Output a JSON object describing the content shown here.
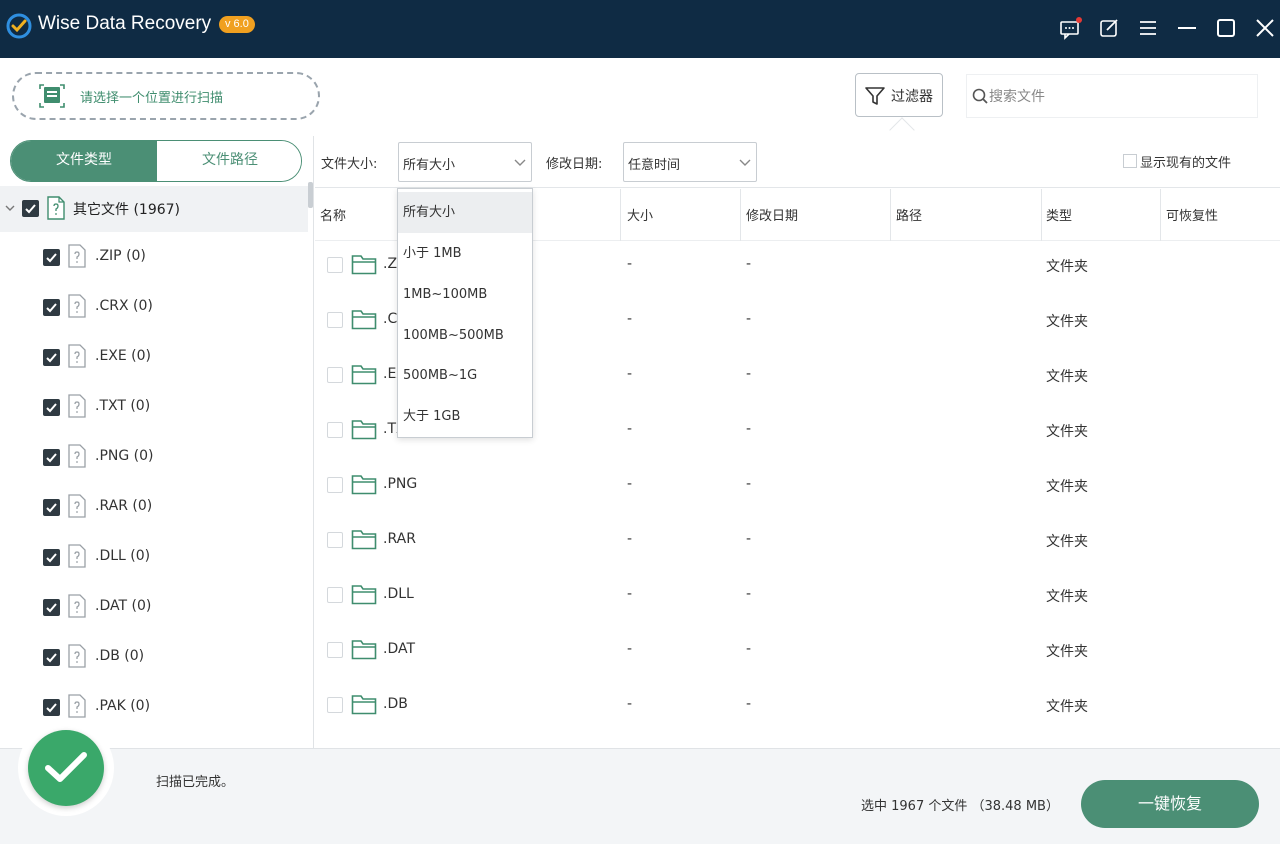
{
  "app": {
    "title": "Wise Data Recovery",
    "version": "v 6.0",
    "accent_color": "#4b8f75",
    "titlebar_color": "#0f2b44"
  },
  "titlebar_icons": [
    "feedback-icon",
    "edit-icon",
    "menu-icon",
    "minimize-icon",
    "maximize-icon",
    "close-icon"
  ],
  "toolbar": {
    "scan_location_label": "请选择一个位置进行扫描",
    "filter_label": "过滤器",
    "search_placeholder": "搜索文件"
  },
  "left_tabs": [
    "文件类型",
    "文件路径"
  ],
  "tree": {
    "root_label": "其它文件 (1967)",
    "items": [
      ".ZIP (0)",
      ".CRX (0)",
      ".EXE (0)",
      ".TXT (0)",
      ".PNG (0)",
      ".RAR (0)",
      ".DLL (0)",
      ".DAT (0)",
      ".DB (0)",
      ".PAK (0)"
    ]
  },
  "filter_bar": {
    "size_label": "文件大小:",
    "size_value": "所有大小",
    "date_label": "修改日期:",
    "date_value": "任意时间",
    "show_existing_label": "显示现有的文件"
  },
  "size_dropdown": {
    "options": [
      "所有大小",
      "小于 1MB",
      "1MB~100MB",
      "100MB~500MB",
      "500MB~1G",
      "大于 1GB"
    ],
    "selected": "所有大小"
  },
  "table": {
    "columns": [
      "名称",
      "大小",
      "修改日期",
      "路径",
      "类型",
      "可恢复性"
    ],
    "rows": [
      {
        "name": ".ZIP",
        "size": "-",
        "date": "-",
        "type": "文件夹"
      },
      {
        "name": ".CRX",
        "size": "-",
        "date": "-",
        "type": "文件夹"
      },
      {
        "name": ".EXE",
        "size": "-",
        "date": "-",
        "type": "文件夹"
      },
      {
        "name": ".TXT",
        "size": "-",
        "date": "-",
        "type": "文件夹"
      },
      {
        "name": ".PNG",
        "size": "-",
        "date": "-",
        "type": "文件夹"
      },
      {
        "name": ".RAR",
        "size": "-",
        "date": "-",
        "type": "文件夹"
      },
      {
        "name": ".DLL",
        "size": "-",
        "date": "-",
        "type": "文件夹"
      },
      {
        "name": ".DAT",
        "size": "-",
        "date": "-",
        "type": "文件夹"
      },
      {
        "name": ".DB",
        "size": "-",
        "date": "-",
        "type": "文件夹"
      }
    ]
  },
  "status": {
    "text": "扫描已完成。",
    "selection_summary": "选中 1967 个文件 （38.48 MB）",
    "recover_label": "一键恢复"
  }
}
